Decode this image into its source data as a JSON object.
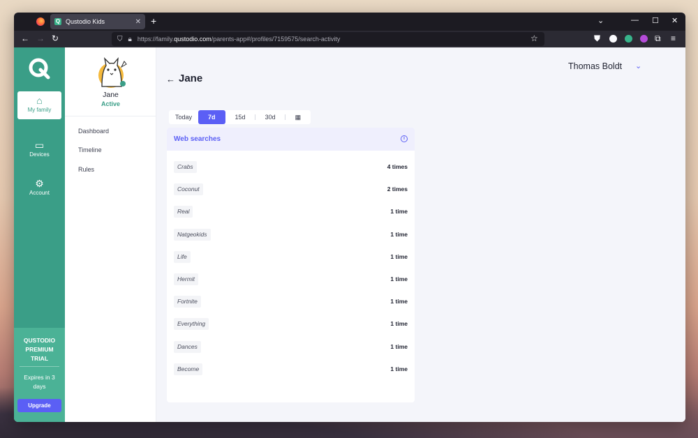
{
  "browser": {
    "tab_title": "Qustodio Kids",
    "url_prefix": "https://family.",
    "url_domain": "qustodio.com",
    "url_path": "/parents-app#/profiles/7159575/search-activity"
  },
  "rail": {
    "items": [
      {
        "label": "My family",
        "icon": "home-icon"
      },
      {
        "label": "Devices",
        "icon": "devices-icon"
      },
      {
        "label": "Account",
        "icon": "gear-icon"
      }
    ],
    "trial_title": "QUSTODIO PREMIUM TRIAL",
    "trial_expires": "Expires in 3 days",
    "upgrade_label": "Upgrade"
  },
  "profile": {
    "name": "Jane",
    "status": "Active",
    "nav": [
      "Dashboard",
      "Timeline",
      "Rules"
    ]
  },
  "header": {
    "child_name": "Jane",
    "user_name": "Thomas Boldt"
  },
  "range": {
    "options": [
      "Today",
      "7d",
      "15d",
      "30d"
    ],
    "selected": "7d"
  },
  "searches": {
    "title": "Web searches",
    "rows": [
      {
        "term": "Crabs",
        "count": "4 times"
      },
      {
        "term": "Coconut",
        "count": "2 times"
      },
      {
        "term": "Real",
        "count": "1 time"
      },
      {
        "term": "Natgeokids",
        "count": "1 time"
      },
      {
        "term": "Life",
        "count": "1 time"
      },
      {
        "term": "Hermit",
        "count": "1 time"
      },
      {
        "term": "Fortnite",
        "count": "1 time"
      },
      {
        "term": "Everything",
        "count": "1 time"
      },
      {
        "term": "Dances",
        "count": "1 time"
      },
      {
        "term": "Become",
        "count": "1 time"
      }
    ]
  },
  "colors": {
    "brand_green": "#3a9e87",
    "accent_purple": "#5b5ff5"
  }
}
